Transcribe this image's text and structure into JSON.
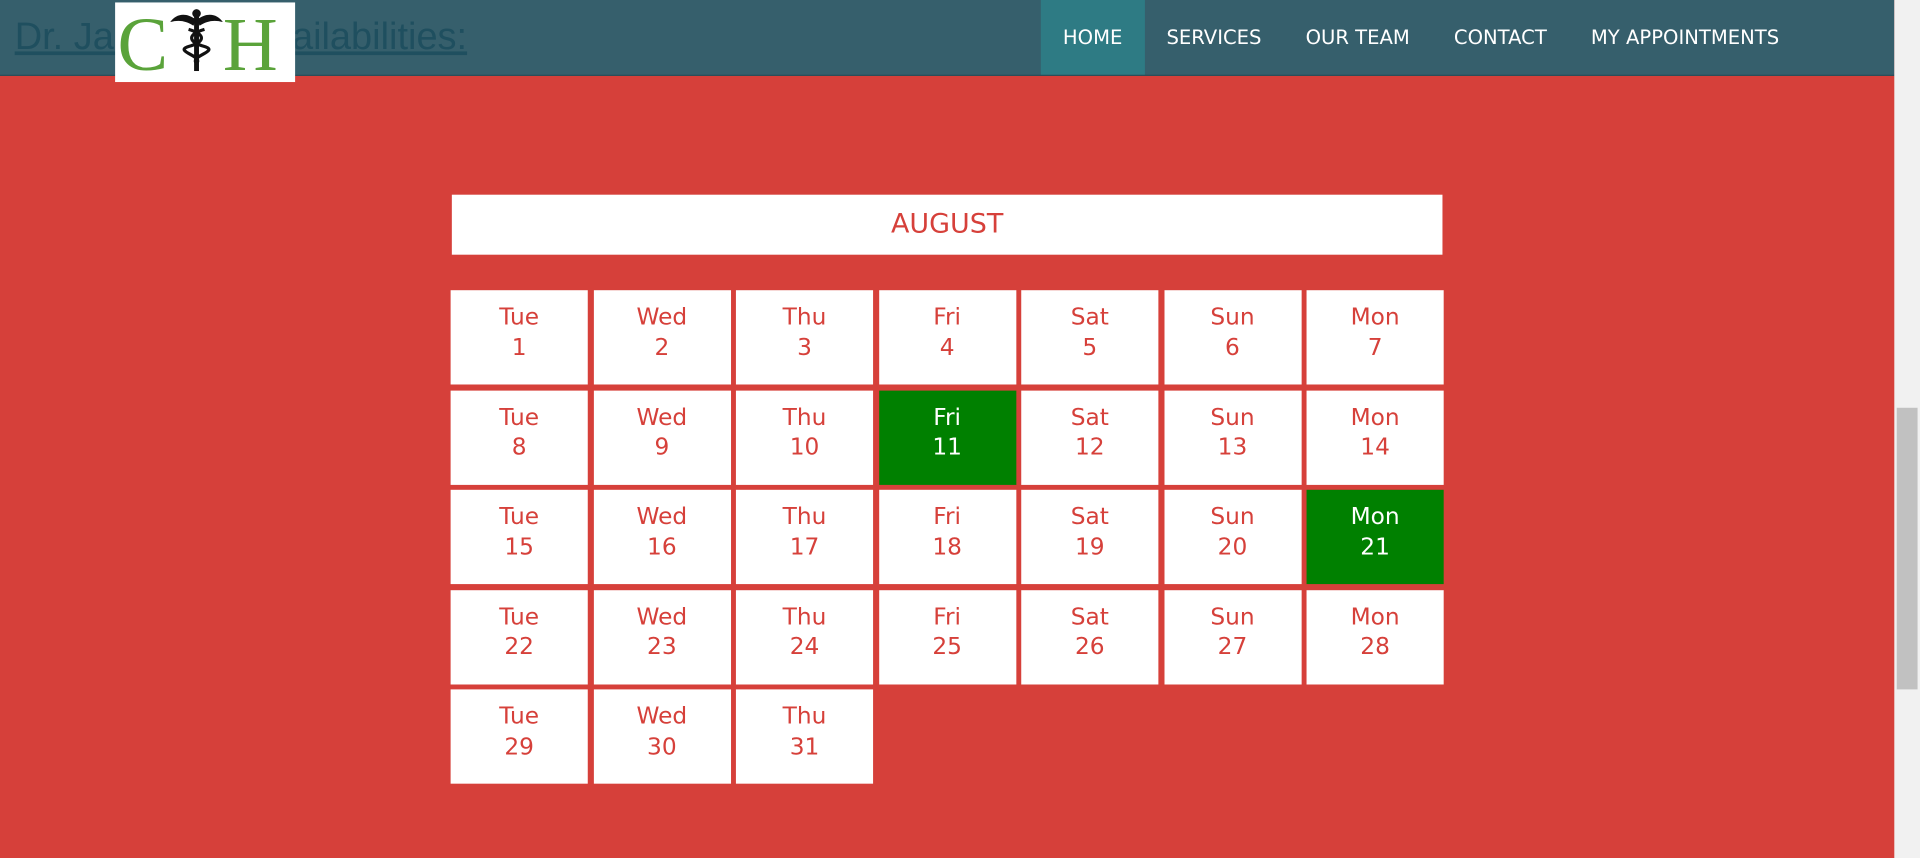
{
  "header": {
    "heading": "Dr. Jasmine's availabilities:",
    "logo_text": "CH",
    "nav": [
      {
        "label": "HOME",
        "active": true
      },
      {
        "label": "SERVICES",
        "active": false
      },
      {
        "label": "OUR TEAM",
        "active": false
      },
      {
        "label": "CONTACT",
        "active": false
      },
      {
        "label": "MY APPOINTMENTS",
        "active": false
      }
    ]
  },
  "calendar": {
    "month": "AUGUST",
    "days": [
      {
        "weekday": "Tue",
        "day": "1",
        "available": false
      },
      {
        "weekday": "Wed",
        "day": "2",
        "available": false
      },
      {
        "weekday": "Thu",
        "day": "3",
        "available": false
      },
      {
        "weekday": "Fri",
        "day": "4",
        "available": false
      },
      {
        "weekday": "Sat",
        "day": "5",
        "available": false
      },
      {
        "weekday": "Sun",
        "day": "6",
        "available": false
      },
      {
        "weekday": "Mon",
        "day": "7",
        "available": false
      },
      {
        "weekday": "Tue",
        "day": "8",
        "available": false
      },
      {
        "weekday": "Wed",
        "day": "9",
        "available": false
      },
      {
        "weekday": "Thu",
        "day": "10",
        "available": false
      },
      {
        "weekday": "Fri",
        "day": "11",
        "available": true
      },
      {
        "weekday": "Sat",
        "day": "12",
        "available": false
      },
      {
        "weekday": "Sun",
        "day": "13",
        "available": false
      },
      {
        "weekday": "Mon",
        "day": "14",
        "available": false
      },
      {
        "weekday": "Tue",
        "day": "15",
        "available": false
      },
      {
        "weekday": "Wed",
        "day": "16",
        "available": false
      },
      {
        "weekday": "Thu",
        "day": "17",
        "available": false
      },
      {
        "weekday": "Fri",
        "day": "18",
        "available": false
      },
      {
        "weekday": "Sat",
        "day": "19",
        "available": false
      },
      {
        "weekday": "Sun",
        "day": "20",
        "available": false
      },
      {
        "weekday": "Mon",
        "day": "21",
        "available": true
      },
      {
        "weekday": "Tue",
        "day": "22",
        "available": false
      },
      {
        "weekday": "Wed",
        "day": "23",
        "available": false
      },
      {
        "weekday": "Thu",
        "day": "24",
        "available": false
      },
      {
        "weekday": "Fri",
        "day": "25",
        "available": false
      },
      {
        "weekday": "Sat",
        "day": "26",
        "available": false
      },
      {
        "weekday": "Sun",
        "day": "27",
        "available": false
      },
      {
        "weekday": "Mon",
        "day": "28",
        "available": false
      },
      {
        "weekday": "Tue",
        "day": "29",
        "available": false
      },
      {
        "weekday": "Wed",
        "day": "30",
        "available": false
      },
      {
        "weekday": "Thu",
        "day": "31",
        "available": false
      }
    ]
  },
  "colors": {
    "page_background": "#d6403a",
    "header_background": "#365f6c",
    "active_nav": "#2e7b84",
    "available_day": "#008000",
    "logo_green": "#5aa33a"
  }
}
